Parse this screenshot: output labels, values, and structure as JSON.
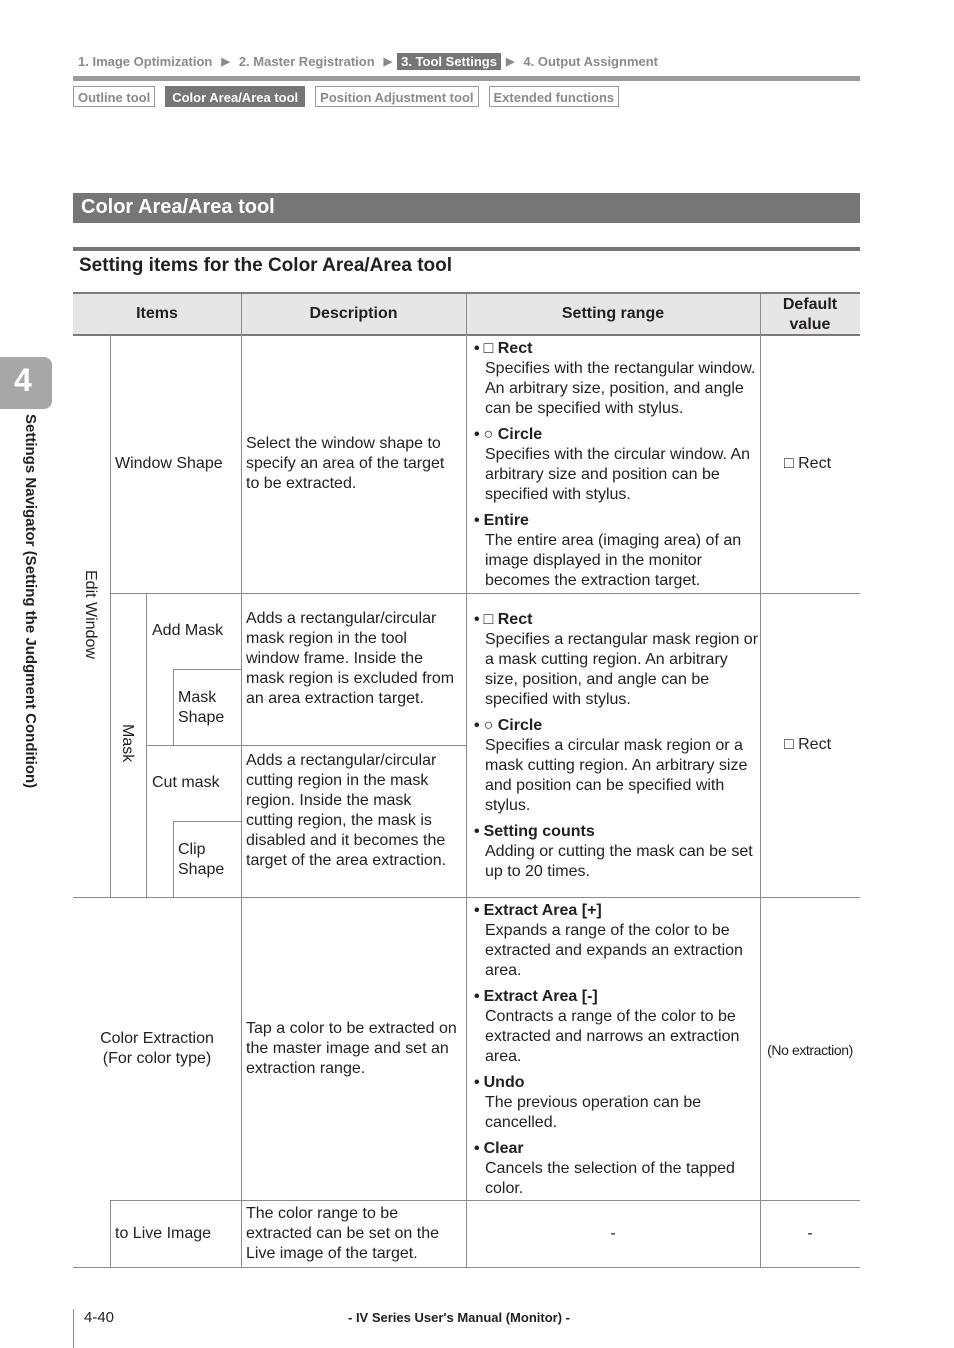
{
  "breadcrumb": {
    "steps": [
      "1. Image Optimization",
      "2. Master Registration",
      "3. Tool Settings",
      "4. Output Assignment"
    ],
    "active_index": 2,
    "separator": "▶"
  },
  "tool_tabs": {
    "items": [
      "Outline tool",
      "Color Area/Area tool",
      "Position Adjustment tool",
      "Extended functions"
    ],
    "active_index": 1
  },
  "section_title": "Color Area/Area tool",
  "subsection_title": "Setting items for the Color Area/Area tool",
  "chapter": {
    "number": "4",
    "label": "Settings Navigator (Setting the Judgment Condition)"
  },
  "table": {
    "headers": {
      "items": "Items",
      "description": "Description",
      "setting_range": "Setting range",
      "default_value_line1": "Default",
      "default_value_line2": "value"
    },
    "group_edit_window": "Edit Window",
    "group_mask": "Mask",
    "rows": {
      "window_shape": {
        "item": "Window Shape",
        "description": "Select the window shape to specify an area of the target to be extracted.",
        "range": [
          {
            "icon": "□",
            "title": "Rect",
            "body": "Specifies with the rectangular window. An arbitrary size, position, and angle can be specified with stylus."
          },
          {
            "icon": "○",
            "title": "Circle",
            "body": "Specifies with the circular window. An arbitrary size and position can be specified with stylus."
          },
          {
            "icon": "",
            "title": "Entire",
            "body": "The entire area (imaging area) of an image displayed in the monitor becomes the extraction target."
          }
        ],
        "default": "□ Rect"
      },
      "mask": {
        "add_mask": "Add Mask",
        "mask_shape_line1": "Mask",
        "mask_shape_line2": "Shape",
        "add_description": "Adds a rectangular/circular mask region in the tool window frame. Inside the mask region is excluded from an area extraction target.",
        "cut_mask": "Cut mask",
        "clip_shape_line1": "Clip",
        "clip_shape_line2": "Shape",
        "cut_description": "Adds a rectangular/circular cutting region in the mask region. Inside the mask cutting region, the mask is disabled and it becomes the target of the area extraction.",
        "range": [
          {
            "icon": "□",
            "title": "Rect",
            "body": "Specifies a rectangular mask region or a mask cutting region. An arbitrary size, position, and angle can be specified with stylus."
          },
          {
            "icon": "○",
            "title": "Circle",
            "body": "Specifies a circular mask region or a mask cutting region. An arbitrary size and position can be specified with stylus."
          },
          {
            "icon": "",
            "title": "Setting counts",
            "body": "Adding or cutting the mask can be set up to 20 times."
          }
        ],
        "default": "□ Rect"
      },
      "color_extraction": {
        "item_line1": "Color Extraction",
        "item_line2": "(For color type)",
        "description": "Tap a color to be extracted on the master image and set an extraction range.",
        "range": [
          {
            "icon": "",
            "title": "Extract Area [+]",
            "body": "Expands a range of the color to be extracted and expands an extraction area."
          },
          {
            "icon": "",
            "title": "Extract Area [-]",
            "body": "Contracts a range of the color to be extracted and narrows an extraction area."
          },
          {
            "icon": "",
            "title": "Undo",
            "body": "The previous operation can be cancelled."
          },
          {
            "icon": "",
            "title": "Clear",
            "body": "Cancels the selection of the tapped color."
          }
        ],
        "default": "(No extraction)"
      },
      "to_live_image": {
        "item": "to Live Image",
        "description": "The color range to be extracted can be set on the Live image of the target.",
        "range": "-",
        "default": "-"
      }
    }
  },
  "footer": {
    "page_number": "4-40",
    "manual_title": "- IV Series User's Manual (Monitor) -"
  }
}
